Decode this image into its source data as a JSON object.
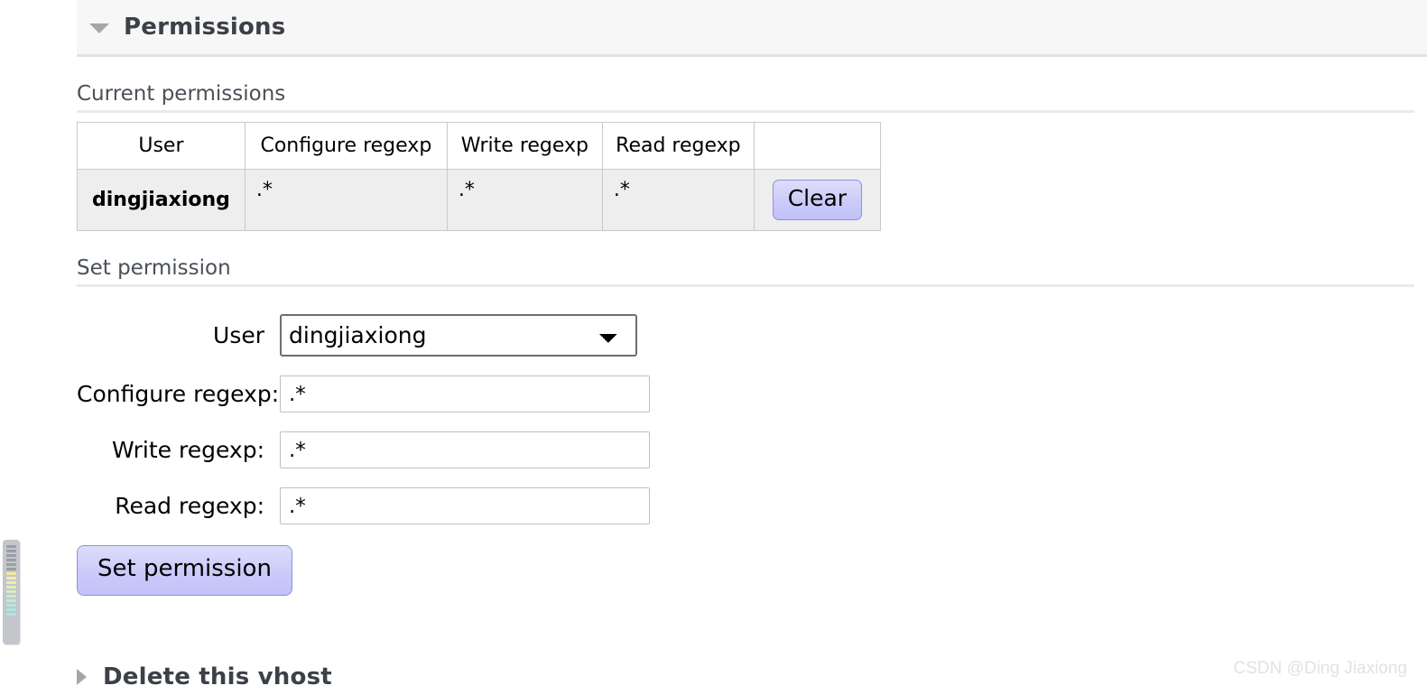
{
  "section": {
    "title": "Permissions",
    "toggle_icon": "triangle-down-icon",
    "expanded": true
  },
  "current_permissions": {
    "label": "Current permissions",
    "columns": [
      "User",
      "Configure regexp",
      "Write regexp",
      "Read regexp",
      ""
    ],
    "rows": [
      {
        "user": "dingjiaxiong",
        "configure_regexp": ".*",
        "write_regexp": ".*",
        "read_regexp": ".*",
        "action_label": "Clear"
      }
    ]
  },
  "set_permission": {
    "label": "Set permission",
    "fields": {
      "user": {
        "label": "User",
        "value": "dingjiaxiong",
        "options": [
          "dingjiaxiong"
        ],
        "dropdown_icon": "chevron-down-icon"
      },
      "configure_regexp": {
        "label": "Configure regexp:",
        "value": ".*",
        "placeholder": ""
      },
      "write_regexp": {
        "label": "Write regexp:",
        "value": ".*",
        "placeholder": ""
      },
      "read_regexp": {
        "label": "Read regexp:",
        "value": ".*",
        "placeholder": ""
      }
    },
    "submit_label": "Set permission"
  },
  "delete_vhost_section": {
    "title": "Delete this vhost",
    "toggle_icon": "triangle-right-icon",
    "expanded": false
  },
  "watermark": {
    "text": "CSDN @Ding Jiaxiong"
  },
  "scroll_widget": {
    "name": "vertical-scroll-indicator"
  },
  "colors": {
    "header_bg": "#f7f7f7",
    "header_text": "#3c4048",
    "row_bg": "#eeeeee",
    "button_fill": "#c9c9fa",
    "button_border": "#8f8fe0",
    "rule": "#eaeaea",
    "watermark": "#e2e2e2"
  }
}
